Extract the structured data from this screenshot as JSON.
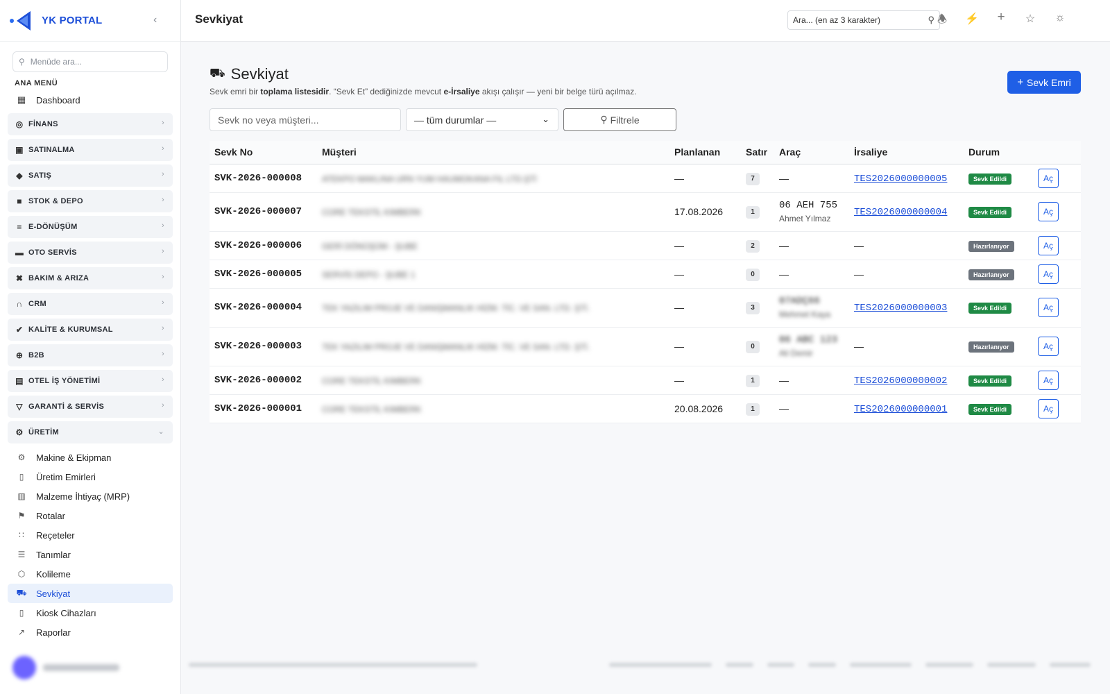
{
  "brand": {
    "name": "YK PORTAL"
  },
  "sidebar": {
    "search_placeholder": "Menüde ara...",
    "section_title": "ANA MENÜ",
    "dashboard": "Dashboard",
    "groups": [
      {
        "label": "FİNANS",
        "icon": "finance-icon"
      },
      {
        "label": "SATINALMA",
        "icon": "bag-icon"
      },
      {
        "label": "SATIŞ",
        "icon": "tag-icon"
      },
      {
        "label": "STOK & DEPO",
        "icon": "box-icon"
      },
      {
        "label": "E-DÖNÜŞÜM",
        "icon": "document-icon"
      },
      {
        "label": "OTO SERVİS",
        "icon": "car-icon"
      },
      {
        "label": "BAKIM & ARIZA",
        "icon": "tools-icon"
      },
      {
        "label": "CRM",
        "icon": "headset-icon"
      },
      {
        "label": "KALİTE & KURUMSAL",
        "icon": "badge-icon"
      },
      {
        "label": "B2B",
        "icon": "globe-icon"
      },
      {
        "label": "OTEL İŞ YÖNETİMİ",
        "icon": "building-icon"
      },
      {
        "label": "GARANTİ & SERVİS",
        "icon": "shield-icon"
      },
      {
        "label": "ÜRETİM",
        "icon": "gear-icon"
      }
    ],
    "sub_items": [
      {
        "label": "Makine & Ekipman",
        "icon": "gear-icon"
      },
      {
        "label": "Üretim Emirleri",
        "icon": "clipboard-icon"
      },
      {
        "label": "Malzeme İhtiyaç (MRP)",
        "icon": "chart-doc-icon"
      },
      {
        "label": "Rotalar",
        "icon": "signpost-icon"
      },
      {
        "label": "Reçeteler",
        "icon": "hierarchy-icon"
      },
      {
        "label": "Tanımlar",
        "icon": "sliders-icon"
      },
      {
        "label": "Kolileme",
        "icon": "package-icon"
      },
      {
        "label": "Sevkiyat",
        "icon": "truck-icon"
      },
      {
        "label": "Kiosk Cihazları",
        "icon": "tablet-icon"
      },
      {
        "label": "Raporlar",
        "icon": "line-chart-icon"
      }
    ]
  },
  "header": {
    "title": "Sevkiyat",
    "search_placeholder": "Ara... (en az 3 karakter)"
  },
  "page": {
    "title": "Sevkiyat",
    "lead_1": "Sevk emri bir ",
    "lead_b1": "toplama listesidir",
    "lead_2": ". “Sevk Et” dediğinizde mevcut ",
    "lead_b2": "e-İrsaliye",
    "lead_3": " akışı çalışır — yeni bir belge türü açılmaz.",
    "new_button": "Sevk Emri",
    "filter_placeholder": "Sevk no veya müşteri...",
    "status_select": "— tüm durumlar —",
    "filter_button": "Filtrele"
  },
  "table": {
    "headers": [
      "Sevk No",
      "Müşteri",
      "Planlanan",
      "Satır",
      "Araç",
      "İrsaliye",
      "Durum",
      ""
    ],
    "rows": [
      {
        "no": "SVK-2026-000008",
        "customer": "ATEKPO MAKLINA URN YUM HAUMOKANA FIL LTD.ŞTİ",
        "planned": "—",
        "lines": "7",
        "vehicle": "—",
        "driver": "",
        "waybill": "TES2026000000005",
        "status": "Sevk Edildi",
        "status_type": "done",
        "action": "Aç"
      },
      {
        "no": "SVK-2026-000007",
        "customer": "CORE TEKSTİL KIMBERK",
        "planned": "17.08.2026",
        "lines": "1",
        "vehicle": "06 AEH 755",
        "driver": "Ahmet Yılmaz",
        "waybill": "TES2026000000004",
        "status": "Sevk Edildi",
        "status_type": "done",
        "action": "Aç"
      },
      {
        "no": "SVK-2026-000006",
        "customer": "GERİ DÖNÜŞÜM - ŞUBE",
        "planned": "—",
        "lines": "2",
        "vehicle": "—",
        "driver": "",
        "waybill": "—",
        "status": "Hazırlanıyor",
        "status_type": "prep",
        "action": "Aç"
      },
      {
        "no": "SVK-2026-000005",
        "customer": "SERVİS DEPO - ŞUBE 1",
        "planned": "—",
        "lines": "0",
        "vehicle": "—",
        "driver": "",
        "waybill": "—",
        "status": "Hazırlanıyor",
        "status_type": "prep",
        "action": "Aç"
      },
      {
        "no": "SVK-2026-000004",
        "customer": "TEK YAZILIM PROJE VE DANIŞMANLIK HİZM. TİC. VE SAN. LTD. ŞTİ.",
        "planned": "—",
        "lines": "3",
        "vehicle": "07ADÇ66",
        "driver": "Mehmet Kaya",
        "waybill": "TES2026000000003",
        "status": "Sevk Edildi",
        "status_type": "done",
        "action": "Aç"
      },
      {
        "no": "SVK-2026-000003",
        "customer": "TEK YAZILIM PROJE VE DANIŞMANLIK HİZM. TİC. VE SAN. LTD. ŞTİ.",
        "planned": "—",
        "lines": "0",
        "vehicle": "06 ABC 123",
        "driver": "Ali Demir",
        "waybill": "—",
        "status": "Hazırlanıyor",
        "status_type": "prep",
        "action": "Aç"
      },
      {
        "no": "SVK-2026-000002",
        "customer": "CORE TEKSTİL KIMBERK",
        "planned": "—",
        "lines": "1",
        "vehicle": "—",
        "driver": "",
        "waybill": "TES2026000000002",
        "status": "Sevk Edildi",
        "status_type": "done",
        "action": "Aç"
      },
      {
        "no": "SVK-2026-000001",
        "customer": "CORE TEKSTİL KIMBERK",
        "planned": "20.08.2026",
        "lines": "1",
        "vehicle": "—",
        "driver": "",
        "waybill": "TES2026000000001",
        "status": "Sevk Edildi",
        "status_type": "done",
        "action": "Aç"
      }
    ]
  },
  "colors": {
    "accent": "#1f5fe6",
    "brand": "#1d4fd8",
    "done": "#1f8a45",
    "prep": "#6c737c"
  }
}
